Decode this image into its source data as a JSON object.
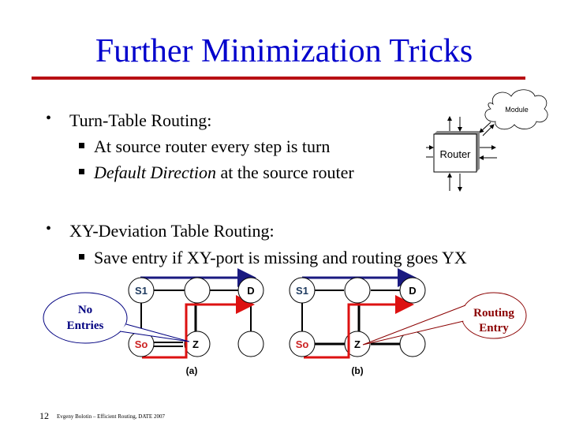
{
  "slide": {
    "title": "Further Minimization Tricks",
    "colors": {
      "title": "#0000cc",
      "rule": "#b81014",
      "route_red": "#dd1111",
      "route_blue": "#1a1a80",
      "callout_blue": "#000080",
      "callout_red": "#8b0000"
    },
    "bullets": [
      {
        "label": "Turn-Table Routing:",
        "subitems": [
          {
            "text": "At source router every step is turn",
            "italic_prefix": ""
          },
          {
            "italic_prefix": "Default Direction",
            "text": " at the source router"
          }
        ]
      },
      {
        "label": "XY-Deviation Table Routing:",
        "subitems": [
          {
            "text": "Save entry if XY-port is missing and routing goes YX",
            "italic_prefix": ""
          }
        ]
      }
    ],
    "router_diagram": {
      "router_label": "Router",
      "module_label": "Module"
    },
    "network_diagrams": [
      {
        "caption": "(a)",
        "nodes": [
          "S1",
          "",
          "D",
          "So",
          "Z",
          ""
        ]
      },
      {
        "caption": "(b)",
        "nodes": [
          "S1",
          "",
          "D",
          "So",
          "Z",
          ""
        ]
      }
    ],
    "callouts": {
      "left": [
        "No",
        "Entries"
      ],
      "right": [
        "Routing",
        "Entry"
      ]
    },
    "footer": {
      "page_number": "12",
      "text": "Evgeny Bolotin – Efficient Routing, DATE 2007"
    }
  }
}
